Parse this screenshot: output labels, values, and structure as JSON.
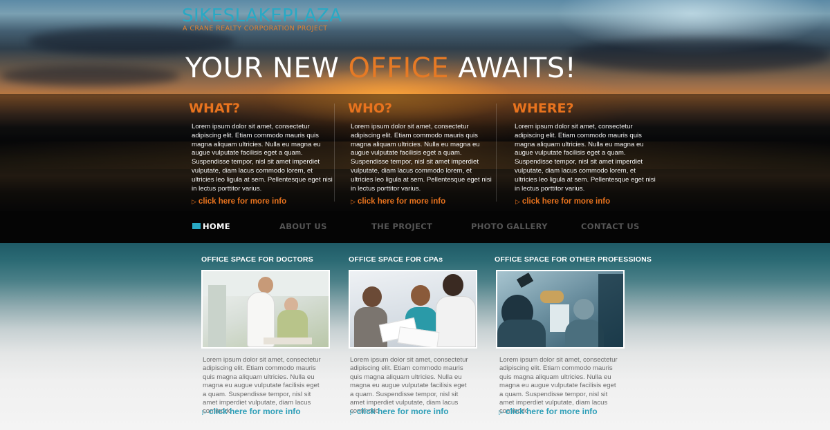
{
  "brand": {
    "title": "SIKESLAKEPLAZA",
    "subtitle": "A CRANE REALTY CORPORATION PROJECT"
  },
  "headline": {
    "part1": "YOUR NEW ",
    "accent": "OFFICE",
    "part2": " AWAITS!"
  },
  "columns": [
    {
      "heading": "WHAT?",
      "body": "Lorem ipsum dolor sit amet, consectetur adipiscing elit. Etiam commodo mauris quis magna aliquam ultricies. Nulla eu magna eu augue vulputate facilisis eget a quam. Suspendisse tempor, nisl sit amet imperdiet vulputate, diam lacus commodo lorem, et ultricies leo ligula at sem. Pellentesque eget nisi in lectus porttitor varius.",
      "link": "click here for more info"
    },
    {
      "heading": "WHO?",
      "body": "Lorem ipsum dolor sit amet, consectetur adipiscing elit. Etiam commodo mauris quis magna aliquam ultricies. Nulla eu magna eu augue vulputate facilisis eget a quam. Suspendisse tempor, nisl sit amet imperdiet vulputate, diam lacus commodo lorem, et ultricies leo ligula at sem. Pellentesque eget nisi in lectus porttitor varius.",
      "link": "click here for more info"
    },
    {
      "heading": "WHERE?",
      "body": "Lorem ipsum dolor sit amet, consectetur adipiscing elit. Etiam commodo mauris quis magna aliquam ultricies. Nulla eu magna eu augue vulputate facilisis eget a quam. Suspendisse tempor, nisl sit amet imperdiet vulputate, diam lacus commodo lorem, et ultricies leo ligula at sem. Pellentesque eget nisi in lectus porttitor varius.",
      "link": "click here for more info"
    }
  ],
  "nav": {
    "items": [
      {
        "label": "HOME",
        "active": true
      },
      {
        "label": "ABOUT US",
        "active": false
      },
      {
        "label": "THE PROJECT",
        "active": false
      },
      {
        "label": "PHOTO GALLERY",
        "active": false
      },
      {
        "label": "CONTACT US",
        "active": false
      }
    ]
  },
  "cards": [
    {
      "heading": "OFFICE SPACE FOR DOCTORS",
      "photo": "doctor-with-patient-photo",
      "body": "Lorem ipsum dolor sit amet, consectetur adipiscing elit. Etiam commodo mauris quis magna aliquam ultricies. Nulla eu magna eu augue vulputate facilisis eget a quam. Suspendisse tempor, nisl sit amet imperdiet vulputate, diam lacus commodo",
      "link": "click here for more info"
    },
    {
      "heading": "OFFICE SPACE FOR CPAs",
      "photo": "business-meeting-photo",
      "body": "Lorem ipsum dolor sit amet, consectetur adipiscing elit. Etiam commodo mauris quis magna aliquam ultricies. Nulla eu magna eu augue vulputate facilisis eget a quam. Suspendisse tempor, nisl sit amet imperdiet vulputate, diam lacus commodo",
      "link": "click here for more info"
    },
    {
      "heading": "OFFICE SPACE FOR OTHER PROFESSIONS",
      "photo": "office-workers-photo",
      "body": "Lorem ipsum dolor sit amet, consectetur adipiscing elit. Etiam commodo mauris quis magna aliquam ultricies. Nulla eu magna eu augue vulputate facilisis eget a quam. Suspendisse tempor, nisl sit amet imperdiet vulputate, diam lacus commodo",
      "link": "click here for more info"
    }
  ],
  "icons": {
    "link_arrow": "chevron-right-icon",
    "home_marker": "home-marker-icon"
  },
  "colors": {
    "brand_teal": "#29a9c4",
    "accent_orange": "#e8731e",
    "nav_bg": "#050505",
    "nav_inactive": "#555555",
    "link_teal": "#2f9fb8"
  }
}
